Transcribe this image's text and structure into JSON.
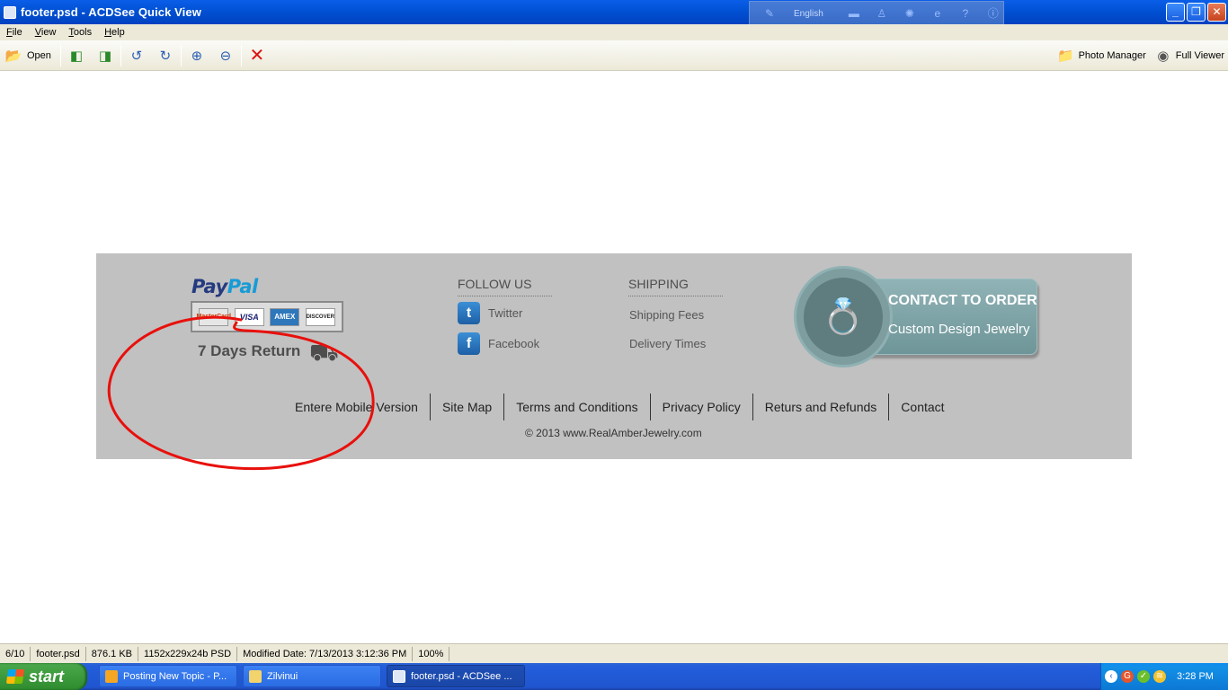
{
  "window": {
    "title": "footer.psd - ACDSee Quick View",
    "language": "English"
  },
  "menu": [
    {
      "key": "F",
      "rest": "ile"
    },
    {
      "key": "V",
      "rest": "iew"
    },
    {
      "key": "T",
      "rest": "ools"
    },
    {
      "key": "H",
      "rest": "elp"
    }
  ],
  "toolbar": {
    "open_label": "Open",
    "photo_manager_label": "Photo Manager",
    "full_viewer_label": "Full Viewer"
  },
  "footer": {
    "paypal": {
      "pay": "Pay",
      "pal": "Pal"
    },
    "cards": [
      "MasterCard",
      "VISA",
      "AMEX",
      "DISCOVER"
    ],
    "returns": "7 Days Return",
    "follow": {
      "heading": "FOLLOW US",
      "twitter": "Twitter",
      "facebook": "Facebook"
    },
    "shipping": {
      "heading": "SHIPPING",
      "fees": "Shipping Fees",
      "times": "Delivery Times"
    },
    "contact": {
      "title": "CONTACT TO ORDER",
      "subtitle": "Custom Design Jewelry"
    },
    "links": [
      "Entere Mobile Version",
      "Site Map",
      "Terms and Conditions",
      "Privacy Policy",
      "Returs and Refunds",
      "Contact"
    ],
    "copyright": "© 2013  www.RealAmberJewelry.com"
  },
  "status": {
    "index": "6/10",
    "filename": "footer.psd",
    "size": "876.1 KB",
    "dims": "1152x229x24b PSD",
    "modified": "Modified Date: 7/13/2013 3:12:36 PM",
    "zoom": "100%"
  },
  "taskbar": {
    "start": "start",
    "tasks": [
      "Posting New Topic - P...",
      "Zilvinui",
      "footer.psd - ACDSee ..."
    ],
    "clock": "3:28 PM"
  },
  "colors": {
    "annotation": "#e8100c",
    "footer_bg": "#c1c1c1",
    "title_bar": "#0151d3"
  }
}
